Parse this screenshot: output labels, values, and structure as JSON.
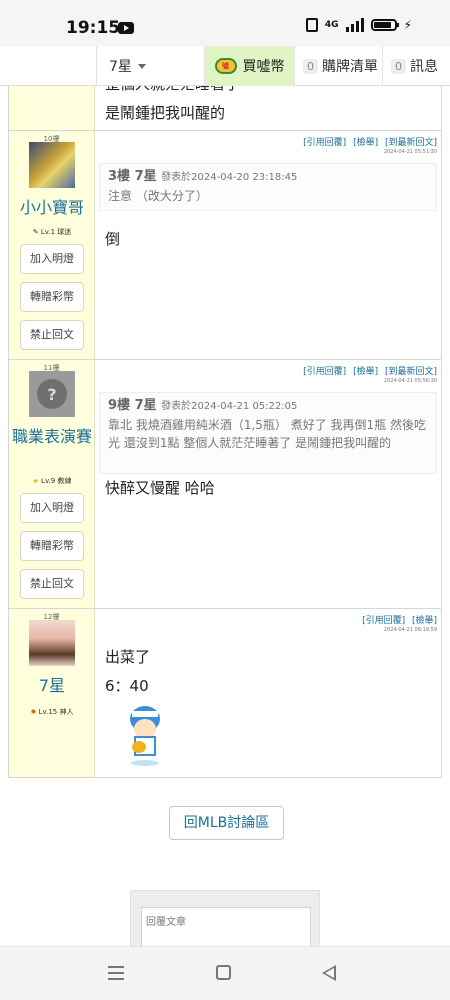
{
  "status_bar": {
    "time": "19:15",
    "network": "4G"
  },
  "nav": {
    "user": "7星",
    "buy_coins": "買噓幣",
    "coin_badge": "噓",
    "cart_count": "0",
    "cart_label": "購牌清單",
    "msg_count": "0",
    "msg_label": "訊息"
  },
  "partial_post": {
    "line1": "整個人就茫茫睡著了",
    "line2": "是鬧鍾把我叫醒的"
  },
  "post_actions": {
    "quote_reply": "[引用回覆]",
    "report": "[檢舉]",
    "latest": "[到最新回文]"
  },
  "posts": [
    {
      "floor": "10樓",
      "username": "小小寶哥",
      "level": "Lv.1 球迷",
      "buttons": [
        "加入明燈",
        "轉贈彩幣",
        "禁止回文"
      ],
      "timestamp": "2024-04-21 05:51:30",
      "quote": {
        "floor_user": "3樓 7星",
        "posted": "發表於2024-04-20 23:18:45",
        "text": "注意 （改大分了）"
      },
      "body": [
        "倒"
      ]
    },
    {
      "floor": "11樓",
      "username": "職業表演賽",
      "level": "Lv.9 教練",
      "buttons": [
        "加入明燈",
        "轉贈彩幣",
        "禁止回文"
      ],
      "timestamp": "2024-04-21 05:56:30",
      "quote": {
        "floor_user": "9樓 7星",
        "posted": "發表於2024-04-21 05:22:05",
        "text": "靠北 我燒酒雞用純米酒（1,5瓶） 煮好了 我再倒1瓶 然後吃光 還沒到1點 整個人就茫茫睡著了 是鬧鍾把我叫醒的"
      },
      "body": [
        "快醉又慢醒 哈哈"
      ]
    },
    {
      "floor": "12樓",
      "username": "7星",
      "level": "Lv.15 神人",
      "timestamp": "2024-04-21 06:19:59",
      "body": [
        "出菜了",
        "6：40"
      ]
    }
  ],
  "back_button": "回MLB討論區",
  "reply": {
    "placeholder": "回覆文章"
  }
}
